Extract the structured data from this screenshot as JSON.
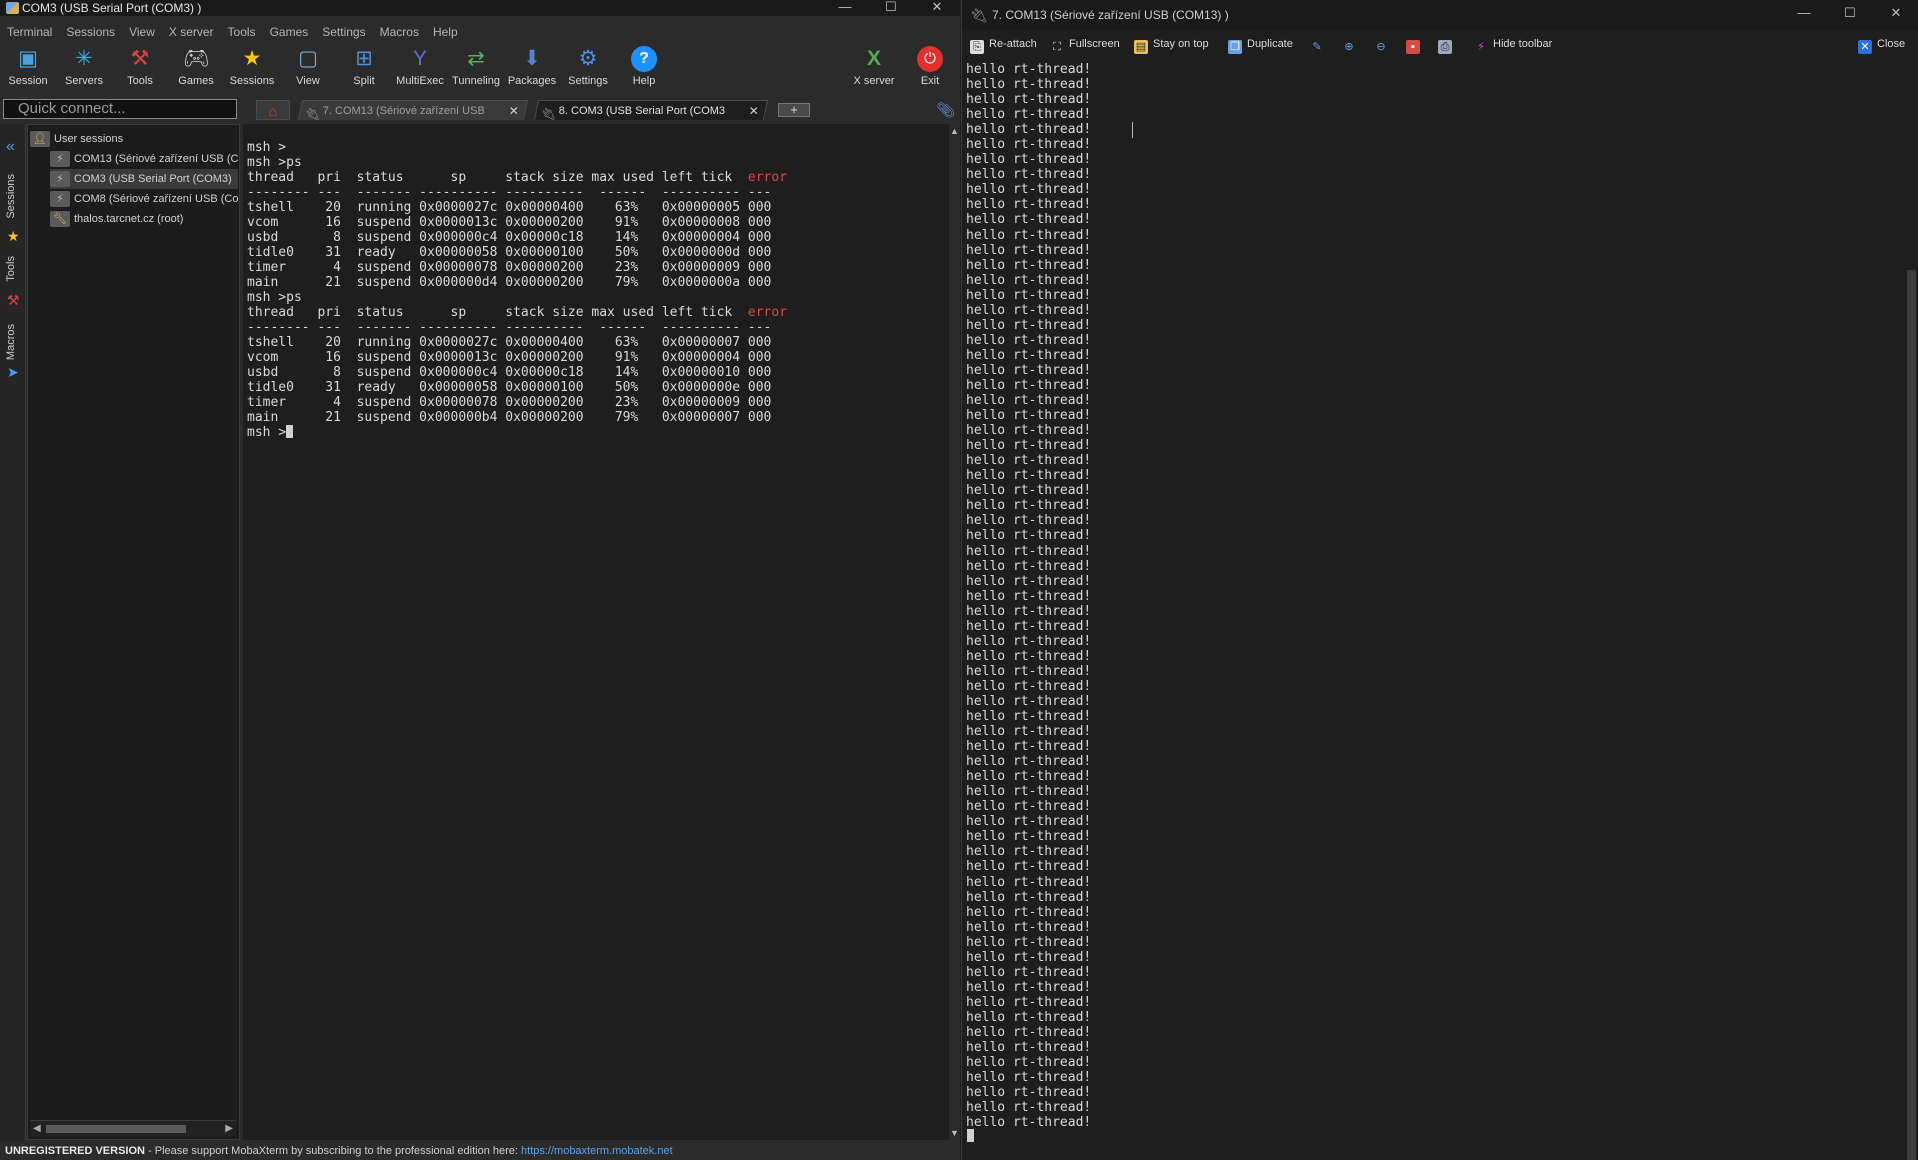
{
  "left_window": {
    "title": "COM3  (USB Serial Port (COM3) )",
    "menu": [
      "Terminal",
      "Sessions",
      "View",
      "X server",
      "Tools",
      "Games",
      "Settings",
      "Macros",
      "Help"
    ],
    "toolbar": [
      {
        "label": "Session",
        "icon": "session-icon",
        "color": "#4aa3df"
      },
      {
        "label": "Servers",
        "icon": "servers-icon",
        "color": "#3bb4e8"
      },
      {
        "label": "Tools",
        "icon": "tools-icon",
        "color": "#e04040"
      },
      {
        "label": "Games",
        "icon": "games-icon",
        "color": "#cfcfcf"
      },
      {
        "label": "Sessions",
        "icon": "star-icon",
        "color": "#f5c518"
      },
      {
        "label": "View",
        "icon": "view-icon",
        "color": "#6fa7d8"
      },
      {
        "label": "Split",
        "icon": "split-icon",
        "color": "#4a90d9"
      },
      {
        "label": "MultiExec",
        "icon": "multiexec-icon",
        "color": "#5a6fd8"
      },
      {
        "label": "Tunneling",
        "icon": "tunneling-icon",
        "color": "#5fae5f"
      },
      {
        "label": "Packages",
        "icon": "packages-icon",
        "color": "#5a82c8"
      },
      {
        "label": "Settings",
        "icon": "gear-icon",
        "color": "#4f8fe0"
      },
      {
        "label": "Help",
        "icon": "help-icon",
        "color": "#1e90ff"
      }
    ],
    "toolbar_right": [
      {
        "label": "X server",
        "icon": "x-server-icon",
        "color": "#4fae4f"
      },
      {
        "label": "Exit",
        "icon": "power-icon",
        "color": "#e03030"
      }
    ],
    "quick_connect_placeholder": "Quick connect...",
    "tabs": [
      {
        "label": "7. COM13  (Sériové zařízení USB",
        "active": false
      },
      {
        "label": "8. COM3  (USB Serial Port (COM3",
        "active": true
      }
    ],
    "side_tabs": [
      "Sessions",
      "Tools",
      "Macros"
    ],
    "sessions": {
      "root": "User sessions",
      "items": [
        {
          "label": "COM13  (Sériové zařízení USB (C",
          "selected": false
        },
        {
          "label": "COM3  (USB Serial Port (COM3)",
          "selected": true
        },
        {
          "label": "COM8  (Sériové zařízení USB (Co",
          "selected": false
        },
        {
          "label": "thalos.tarcnet.cz (root)",
          "selected": false
        }
      ]
    },
    "terminal": {
      "prompt1": "msh >",
      "cmd1": "msh >ps",
      "header": "thread   pri  status      sp     stack size max used left tick  ",
      "header_error": "error",
      "separator": "-------- ---  ------- ---------- ----------  ------  ---------- ---",
      "table1": [
        "tshell    20  running 0x0000027c 0x00000400    63%   0x00000005 000",
        "vcom      16  suspend 0x0000013c 0x00000200    91%   0x00000008 000",
        "usbd       8  suspend 0x000000c4 0x00000c18    14%   0x00000004 000",
        "tidle0    31  ready   0x00000058 0x00000100    50%   0x0000000d 000",
        "timer      4  suspend 0x00000078 0x00000200    23%   0x00000009 000",
        "main      21  suspend 0x000000d4 0x00000200    79%   0x0000000a 000"
      ],
      "cmd2": "msh >ps",
      "table2": [
        "tshell    20  running 0x0000027c 0x00000400    63%   0x00000007 000",
        "vcom      16  suspend 0x0000013c 0x00000200    91%   0x00000004 000",
        "usbd       8  suspend 0x000000c4 0x00000c18    14%   0x00000010 000",
        "tidle0    31  ready   0x00000058 0x00000100    50%   0x0000000e 000",
        "timer      4  suspend 0x00000078 0x00000200    23%   0x00000009 000",
        "main      21  suspend 0x000000b4 0x00000200    79%   0x00000007 000"
      ],
      "final_prompt": "msh >"
    },
    "status": {
      "unregistered": "UNREGISTERED VERSION",
      "message": "  -  Please support MobaXterm by subscribing to the professional edition here:  ",
      "link": "https://mobaxterm.mobatek.net"
    }
  },
  "right_window": {
    "title": "7. COM13  (Sériové zařízení USB (COM13) )",
    "toolbar": [
      {
        "label": "Re-attach",
        "icon": "reattach-icon"
      },
      {
        "label": "Fullscreen",
        "icon": "fullscreen-icon"
      },
      {
        "label": "Stay on top",
        "icon": "stay-on-top-icon"
      },
      {
        "label": "Duplicate",
        "icon": "duplicate-icon"
      },
      {
        "label": "",
        "icon": "edit-icon"
      },
      {
        "label": "",
        "icon": "zoom-in-icon"
      },
      {
        "label": "",
        "icon": "zoom-out-icon"
      },
      {
        "label": "",
        "icon": "save-icon"
      },
      {
        "label": "",
        "icon": "print-icon"
      },
      {
        "label": "Hide toolbar",
        "icon": "lightning-icon"
      },
      {
        "label": "Close",
        "icon": "close-icon"
      }
    ],
    "output_line": "hello rt-thread!",
    "output_line_count": 71
  }
}
